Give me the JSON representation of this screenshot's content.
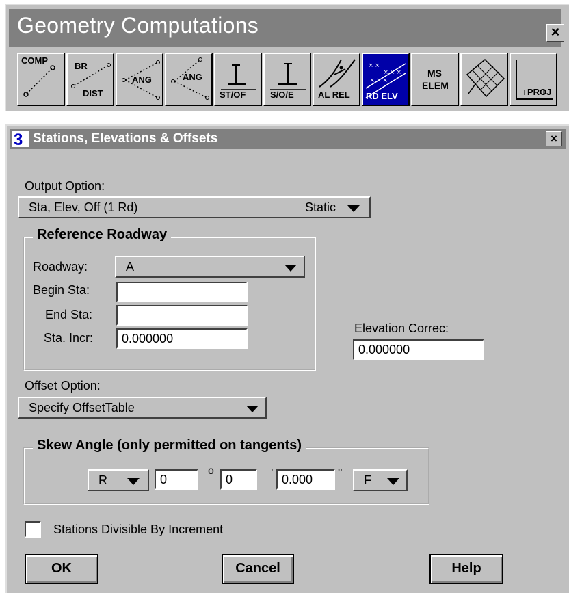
{
  "toolbar_window": {
    "title": "Geometry Computations",
    "close_glyph": "×",
    "tools": [
      {
        "lines": [
          "COMP",
          ""
        ],
        "icon": "compute-point-icon"
      },
      {
        "lines": [
          "BR",
          "DIST"
        ],
        "icon": "bearing-distance-icon"
      },
      {
        "lines": [
          "ANG",
          ""
        ],
        "icon": "angle-icon"
      },
      {
        "lines": [
          "ANG",
          ""
        ],
        "icon": "angle-icon"
      },
      {
        "lines": [
          "ST/OF",
          ""
        ],
        "icon": "station-offset-icon"
      },
      {
        "lines": [
          "S/O/E",
          ""
        ],
        "icon": "station-offset-elevation-icon"
      },
      {
        "lines": [
          "AL REL",
          ""
        ],
        "icon": "alignment-relation-icon"
      },
      {
        "lines": [
          "RD ELV",
          ""
        ],
        "icon": "roadway-elevation-icon",
        "active": true
      },
      {
        "lines": [
          "MS",
          "ELEM"
        ],
        "icon": "microstation-element-icon"
      },
      {
        "lines": [
          "",
          ""
        ],
        "icon": "crosshatch-icon"
      },
      {
        "lines": [
          "PROJ",
          ""
        ],
        "icon": "projection-icon"
      }
    ]
  },
  "dialog": {
    "title": "Stations, Elevations & Offsets",
    "close_glyph": "×",
    "output_option": {
      "label": "Output Option:",
      "value": "Sta, Elev, Off (1 Rd)",
      "kind": "Static"
    },
    "reference_roadway": {
      "title": "Reference Roadway",
      "roadway_label": "Roadway:",
      "roadway_value": "A",
      "begin_sta_label": "Begin Sta:",
      "begin_sta_value": "",
      "end_sta_label": "End Sta:",
      "end_sta_value": "",
      "sta_incr_label": "Sta. Incr:",
      "sta_incr_value": "0.000000"
    },
    "elevation_correction": {
      "label": "Elevation Correc:",
      "value": "0.000000"
    },
    "offset_option": {
      "label": "Offset Option:",
      "value": "Specify OffsetTable"
    },
    "skew_angle": {
      "title": "Skew Angle (only permitted on tangents)",
      "direction": "R",
      "degrees": "0",
      "degree_symbol": "o",
      "minutes": "0",
      "minute_symbol": "'",
      "seconds": "0.000",
      "second_symbol": "\"",
      "face": "F"
    },
    "stations_divisible": {
      "label": "Stations Divisible By Increment",
      "checked": false
    },
    "buttons": {
      "ok": "OK",
      "cancel": "Cancel",
      "help": "Help"
    }
  },
  "colors": {
    "face": "#c0c0c0",
    "title_bar": "#808080",
    "active_tool": "#0000a8"
  }
}
